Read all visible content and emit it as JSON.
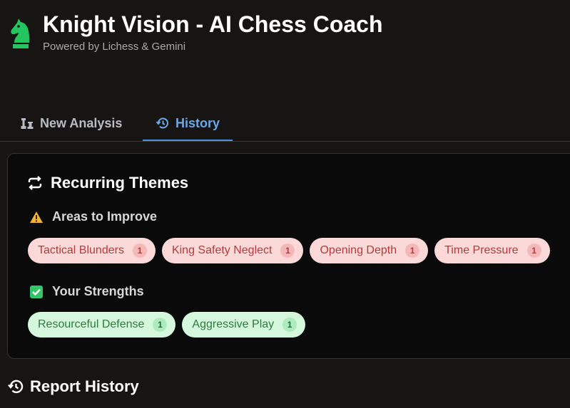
{
  "header": {
    "title": "Knight Vision - AI Chess Coach",
    "subtitle": "Powered by Lichess & Gemini",
    "logo_color": "#22c55e"
  },
  "tabs": [
    {
      "label": "New Analysis",
      "icon": "chess-pieces-icon",
      "active": false
    },
    {
      "label": "History",
      "icon": "history-icon",
      "active": true
    }
  ],
  "themes": {
    "title": "Recurring Themes",
    "improve": {
      "title": "Areas to Improve",
      "items": [
        {
          "label": "Tactical Blunders",
          "count": "1"
        },
        {
          "label": "King Safety Neglect",
          "count": "1"
        },
        {
          "label": "Opening Depth",
          "count": "1"
        },
        {
          "label": "Time Pressure",
          "count": "1"
        }
      ]
    },
    "strengths": {
      "title": "Your Strengths",
      "items": [
        {
          "label": "Resourceful Defense",
          "count": "1"
        },
        {
          "label": "Aggressive Play",
          "count": "1"
        }
      ]
    }
  },
  "report_history": {
    "title": "Report History"
  },
  "colors": {
    "accent_blue": "#6aa8e8",
    "improve_bg": "#fcd9d9",
    "strength_bg": "#d5f8dd"
  }
}
